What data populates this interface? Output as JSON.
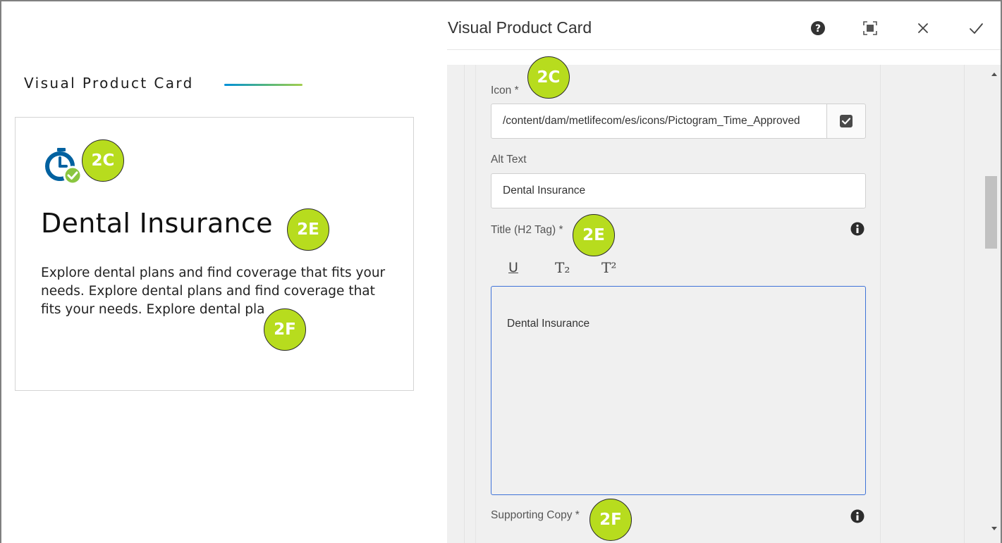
{
  "preview": {
    "section_heading": "Visual Product Card",
    "card": {
      "icon": "stopwatch-check-icon",
      "title": "Dental Insurance",
      "body": "Explore dental plans and find coverage that fits your needs. Explore dental plans and find coverage that fits your needs. Explore dental pla"
    }
  },
  "dialog": {
    "title": "Visual Product Card",
    "header_buttons": {
      "help": "help-icon",
      "fullscreen": "fullscreen-icon",
      "close": "close-icon",
      "done": "done-icon"
    },
    "fields": {
      "icon": {
        "label": "Icon *",
        "value": "/content/dam/metlifecom/es/icons/Pictogram_Time_Approved"
      },
      "alt_text": {
        "label": "Alt Text",
        "value": "Dental Insurance"
      },
      "title": {
        "label": "Title (H2 Tag) *",
        "toolbar": [
          "U",
          "T₂",
          "T²"
        ],
        "value": "Dental Insurance"
      },
      "supporting_copy": {
        "label": "Supporting Copy *"
      }
    }
  },
  "annotations": {
    "badge_2c": "2C",
    "badge_2e": "2E",
    "badge_2f": "2F"
  },
  "colors": {
    "badge_fill": "#b7dc1e",
    "icon_blue": "#0061a0",
    "icon_green": "#8ac640",
    "focus_border": "#3f73d8",
    "heading_gradient_start": "#0090da",
    "heading_gradient_end": "#a4ce4e"
  }
}
